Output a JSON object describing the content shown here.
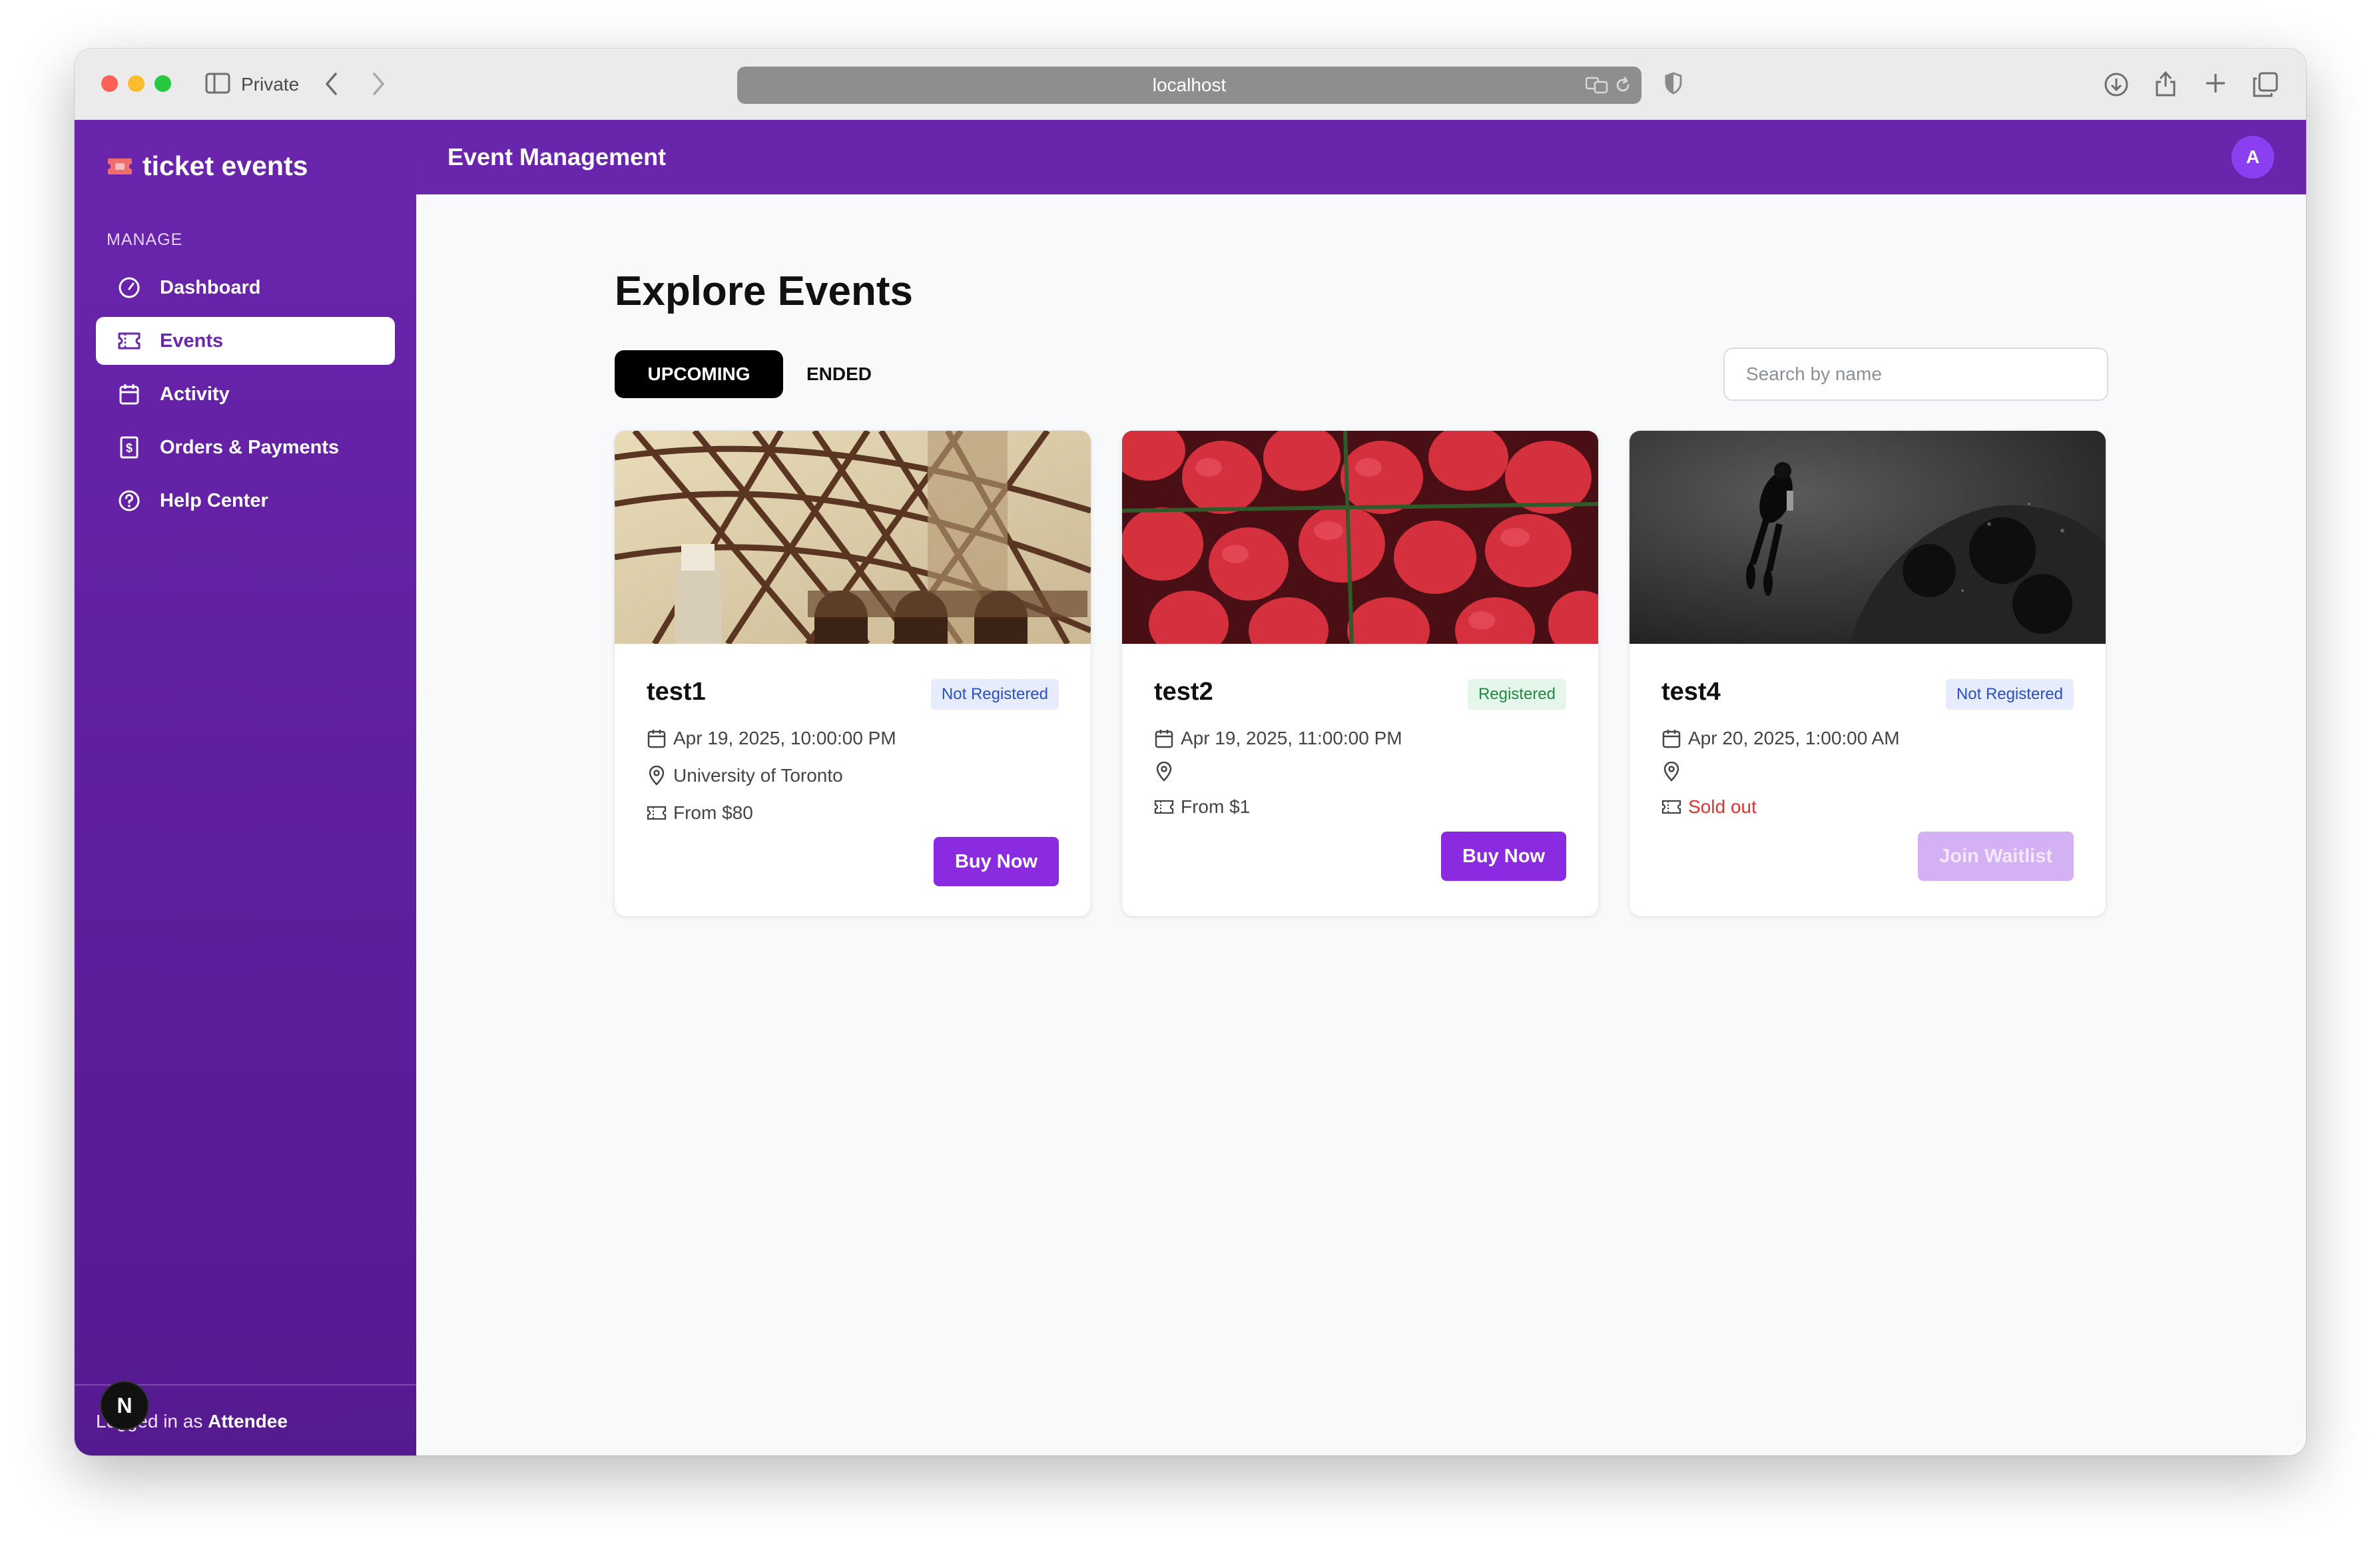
{
  "browser": {
    "mode_label": "Private",
    "url": "localhost"
  },
  "sidebar": {
    "brand": "ticket events",
    "section_label": "MANAGE",
    "items": [
      {
        "label": "Dashboard",
        "icon": "gauge-icon",
        "active": false
      },
      {
        "label": "Events",
        "icon": "ticket-icon",
        "active": true
      },
      {
        "label": "Activity",
        "icon": "calendar-icon",
        "active": false
      },
      {
        "label": "Orders & Payments",
        "icon": "receipt-dollar-icon",
        "active": false
      },
      {
        "label": "Help Center",
        "icon": "help-circle-icon",
        "active": false
      }
    ],
    "footer": {
      "prefix": "Logged in as ",
      "role": "Attendee",
      "dev_badge": "N"
    }
  },
  "topbar": {
    "title": "Event Management",
    "avatar_initial": "A"
  },
  "main": {
    "title": "Explore Events",
    "tabs": [
      {
        "label": "UPCOMING",
        "active": true
      },
      {
        "label": "ENDED",
        "active": false
      }
    ],
    "search": {
      "placeholder": "Search by name",
      "value": ""
    },
    "events": [
      {
        "name": "test1",
        "status": "Not Registered",
        "date": "Apr 19, 2025, 10:00:00 PM",
        "location": "University of Toronto",
        "price": "From $80",
        "action": "Buy Now"
      },
      {
        "name": "test2",
        "status": "Registered",
        "date": "Apr 19, 2025, 11:00:00 PM",
        "location": "",
        "price": "From $1",
        "action": "Buy Now"
      },
      {
        "name": "test4",
        "status": "Not Registered",
        "date": "Apr 20, 2025, 1:00:00 AM",
        "location": "",
        "price": "Sold out",
        "action": "Join Waitlist"
      }
    ]
  },
  "colors": {
    "brand_purple": "#6a25ad",
    "button_purple": "#8a2be2",
    "sold_out_red": "#e03131",
    "registered_green": "#1f8a43",
    "not_registered_blue": "#2b4fc7"
  }
}
